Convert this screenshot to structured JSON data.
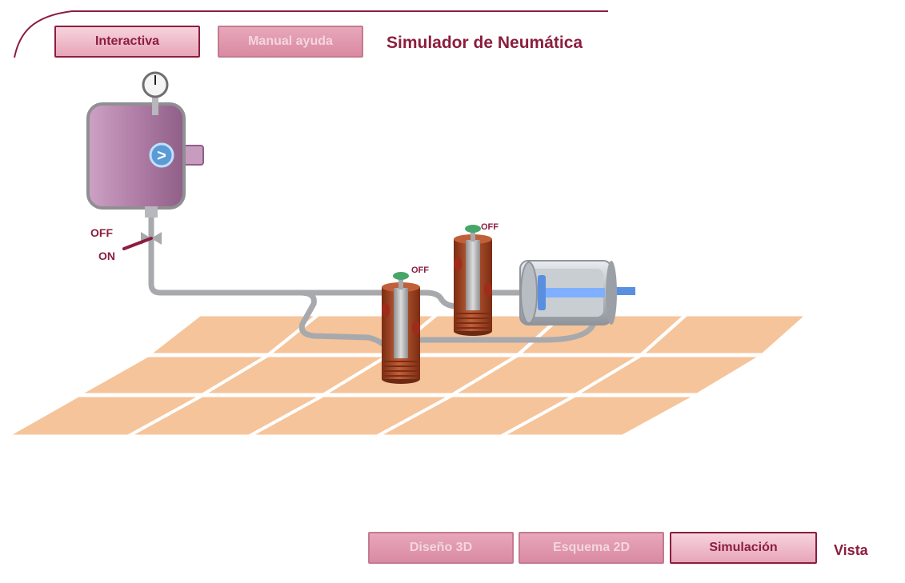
{
  "header": {
    "buttons": [
      {
        "label": "Interactiva"
      },
      {
        "label": "Manual ayuda"
      }
    ],
    "title": "Simulador de Neumática"
  },
  "footer": {
    "buttons": [
      {
        "label": "Diseño 3D"
      },
      {
        "label": "Esquema 2D"
      },
      {
        "label": "Simulación"
      }
    ],
    "label": "Vista"
  },
  "scene": {
    "compressor_arrow": ">",
    "valve_labels": {
      "off": "OFF",
      "on": "ON"
    },
    "spool_valve_1_status": "OFF",
    "spool_valve_2_status": "OFF"
  },
  "colors": {
    "brand": "#8b1e3f",
    "button_fill": "#e7a5b8",
    "tank_fill": "#b98ab0",
    "floor_tile": "#f6c49a",
    "pipe": "#a7a9ad",
    "valve_body": "#b5532f",
    "piston": "#5a8fe0"
  },
  "icons": {
    "pressure_gauge": "gauge-icon",
    "flow_direction": "arrow-right-icon"
  }
}
